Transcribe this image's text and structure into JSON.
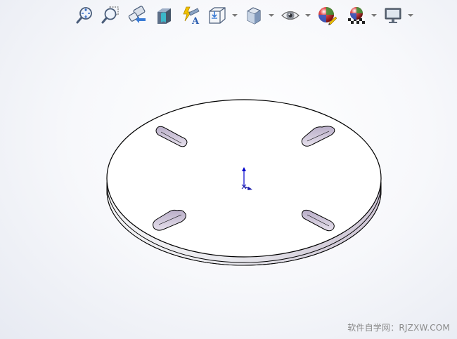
{
  "toolbar": {
    "buttons": [
      {
        "name": "zoom-to-fit",
        "icon": "zoom-to-fit-icon"
      },
      {
        "name": "zoom-to-area",
        "icon": "zoom-to-area-icon"
      },
      {
        "name": "previous-view",
        "icon": "previous-view-icon"
      },
      {
        "name": "section-view",
        "icon": "section-view-icon"
      },
      {
        "name": "dynamic-annotation-views",
        "icon": "dynamic-annotation-icon"
      },
      {
        "name": "view-orientation",
        "icon": "view-orientation-icon",
        "has_dropdown": true
      },
      {
        "name": "display-style",
        "icon": "display-style-icon",
        "has_dropdown": true
      },
      {
        "name": "hide-show-items",
        "icon": "eye-icon",
        "has_dropdown": true
      },
      {
        "name": "edit-appearance",
        "icon": "edit-appearance-icon"
      },
      {
        "name": "apply-scene",
        "icon": "apply-scene-icon",
        "has_dropdown": true
      },
      {
        "name": "view-settings",
        "icon": "monitor-icon",
        "has_dropdown": true
      }
    ]
  },
  "colors": {
    "axis_y": "#0000cc",
    "axis_x": "#1a1aa8",
    "part_face": "#ffffff",
    "part_edge": "#000000",
    "slot_shadow": "#c9c0d6"
  },
  "watermark": "软件自学网：RJZXW.COM"
}
